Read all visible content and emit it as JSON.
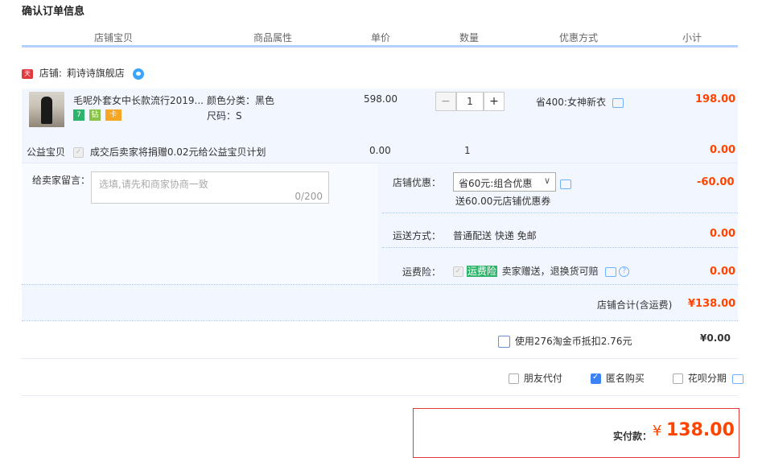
{
  "page_title": "确认订单信息",
  "columns": [
    "店铺宝贝",
    "商品属性",
    "单价",
    "数量",
    "优惠方式",
    "小计"
  ],
  "shop": {
    "tmall_badge": "天猫",
    "label": "店铺:",
    "name": "莉诗诗旗舰店"
  },
  "item": {
    "title": "毛呢外套女中长款流行2019...",
    "attr_color": "颜色分类：黑色",
    "attr_size": "尺码：S",
    "unit_price": "598.00",
    "quantity": "1",
    "qty_minus": "−",
    "qty_plus": "+",
    "discount": "省400:女神新衣",
    "subtotal": "198.00",
    "badges": [
      "7",
      "钻",
      "卡"
    ]
  },
  "charity": {
    "label": "公益宝贝",
    "text": "成交后卖家将捐赠0.02元给公益宝贝计划",
    "price": "0.00",
    "quantity": "1",
    "subtotal": "0.00"
  },
  "message": {
    "label": "给卖家留言：",
    "placeholder": "选填,请先和商家协商一致",
    "counter": "0/200"
  },
  "shop_discount": {
    "label": "店铺优惠：",
    "selected": "省60元:组合优惠",
    "note": "送60.00元店铺优惠券",
    "amount": "-60.00"
  },
  "shipping": {
    "label": "运送方式：",
    "value": "普通配送 快递 免邮",
    "amount": "0.00"
  },
  "insurance": {
    "label": "运费险：",
    "tag": "运费险",
    "text": "卖家赠送，退换货可赔",
    "amount": "0.00"
  },
  "shop_total": {
    "label": "店铺合计(含运费)",
    "value": "¥138.00"
  },
  "coins": {
    "text": "使用276淘金币抵扣2.76元",
    "value": "¥0.00"
  },
  "options": {
    "friend_pay": "朋友代付",
    "anonymous": "匿名购买",
    "installment": "花呗分期"
  },
  "payment": {
    "label": "实付款：",
    "currency": "¥",
    "amount": "138.00"
  },
  "colors": {
    "accent": "#f40",
    "header_border": "#b2d1ff",
    "row_bg": "#f2f7ff",
    "pay_border": "#e4393c"
  }
}
